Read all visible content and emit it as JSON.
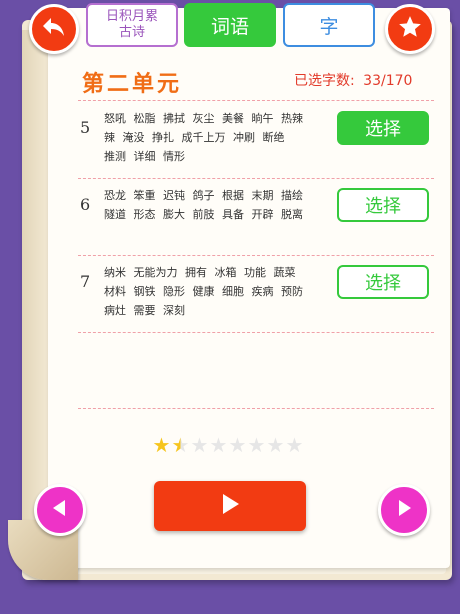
{
  "header": {
    "tabs": [
      {
        "label_line1": "日积月累",
        "label_line2": "古诗"
      },
      {
        "label": "词语"
      },
      {
        "label": "字"
      }
    ]
  },
  "unit": {
    "title": "第二单元",
    "selected_label": "已选字数:",
    "selected_value": "33/170"
  },
  "lessons": [
    {
      "number": "5",
      "lines": [
        "怒吼 松脂 拂拭 灰尘 美餐 晌午 热辣",
        "辣 淹没 挣扎 成千上万 冲刷 断绝",
        "推测 详细 情形"
      ],
      "select_label": "选择",
      "selected": true
    },
    {
      "number": "6",
      "lines": [
        "恐龙 笨重 迟钝 鸽子 根据 末期 描绘",
        "隧道 形态 膨大 前肢 具备 开辟 脱离"
      ],
      "select_label": "选择",
      "selected": false
    },
    {
      "number": "7",
      "lines": [
        "纳米 无能为力 拥有 冰箱 功能 蔬菜",
        "材料 钢铁 隐形 健康 细胞 疾病 预防",
        "病灶 需要 深刻"
      ],
      "select_label": "选择",
      "selected": false
    }
  ],
  "rating": {
    "stars_total": 8,
    "stars_filled": 1.5
  },
  "colors": {
    "accent_red": "#f23b12",
    "green": "#35c93c",
    "magenta": "#ee33c7",
    "background": "#6a4fa6"
  },
  "icons": {
    "back": "back-arrow-icon",
    "favorite": "star-icon",
    "prev": "triangle-left-icon",
    "next": "triangle-right-icon",
    "play": "play-icon"
  }
}
